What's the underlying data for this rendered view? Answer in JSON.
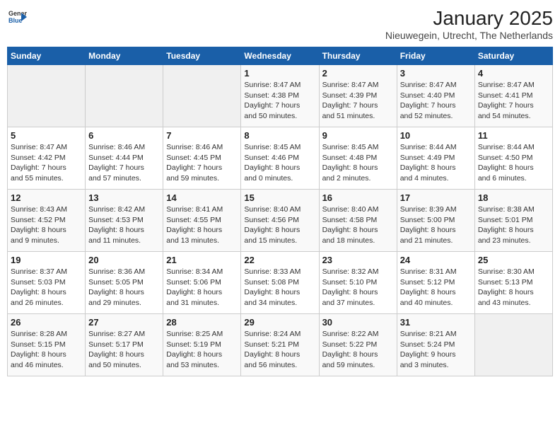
{
  "header": {
    "logo_text1": "General",
    "logo_text2": "Blue",
    "title": "January 2025",
    "subtitle": "Nieuwegein, Utrecht, The Netherlands"
  },
  "weekdays": [
    "Sunday",
    "Monday",
    "Tuesday",
    "Wednesday",
    "Thursday",
    "Friday",
    "Saturday"
  ],
  "weeks": [
    [
      {
        "day": "",
        "info": ""
      },
      {
        "day": "",
        "info": ""
      },
      {
        "day": "",
        "info": ""
      },
      {
        "day": "1",
        "info": "Sunrise: 8:47 AM\nSunset: 4:38 PM\nDaylight: 7 hours\nand 50 minutes."
      },
      {
        "day": "2",
        "info": "Sunrise: 8:47 AM\nSunset: 4:39 PM\nDaylight: 7 hours\nand 51 minutes."
      },
      {
        "day": "3",
        "info": "Sunrise: 8:47 AM\nSunset: 4:40 PM\nDaylight: 7 hours\nand 52 minutes."
      },
      {
        "day": "4",
        "info": "Sunrise: 8:47 AM\nSunset: 4:41 PM\nDaylight: 7 hours\nand 54 minutes."
      }
    ],
    [
      {
        "day": "5",
        "info": "Sunrise: 8:47 AM\nSunset: 4:42 PM\nDaylight: 7 hours\nand 55 minutes."
      },
      {
        "day": "6",
        "info": "Sunrise: 8:46 AM\nSunset: 4:44 PM\nDaylight: 7 hours\nand 57 minutes."
      },
      {
        "day": "7",
        "info": "Sunrise: 8:46 AM\nSunset: 4:45 PM\nDaylight: 7 hours\nand 59 minutes."
      },
      {
        "day": "8",
        "info": "Sunrise: 8:45 AM\nSunset: 4:46 PM\nDaylight: 8 hours\nand 0 minutes."
      },
      {
        "day": "9",
        "info": "Sunrise: 8:45 AM\nSunset: 4:48 PM\nDaylight: 8 hours\nand 2 minutes."
      },
      {
        "day": "10",
        "info": "Sunrise: 8:44 AM\nSunset: 4:49 PM\nDaylight: 8 hours\nand 4 minutes."
      },
      {
        "day": "11",
        "info": "Sunrise: 8:44 AM\nSunset: 4:50 PM\nDaylight: 8 hours\nand 6 minutes."
      }
    ],
    [
      {
        "day": "12",
        "info": "Sunrise: 8:43 AM\nSunset: 4:52 PM\nDaylight: 8 hours\nand 9 minutes."
      },
      {
        "day": "13",
        "info": "Sunrise: 8:42 AM\nSunset: 4:53 PM\nDaylight: 8 hours\nand 11 minutes."
      },
      {
        "day": "14",
        "info": "Sunrise: 8:41 AM\nSunset: 4:55 PM\nDaylight: 8 hours\nand 13 minutes."
      },
      {
        "day": "15",
        "info": "Sunrise: 8:40 AM\nSunset: 4:56 PM\nDaylight: 8 hours\nand 15 minutes."
      },
      {
        "day": "16",
        "info": "Sunrise: 8:40 AM\nSunset: 4:58 PM\nDaylight: 8 hours\nand 18 minutes."
      },
      {
        "day": "17",
        "info": "Sunrise: 8:39 AM\nSunset: 5:00 PM\nDaylight: 8 hours\nand 21 minutes."
      },
      {
        "day": "18",
        "info": "Sunrise: 8:38 AM\nSunset: 5:01 PM\nDaylight: 8 hours\nand 23 minutes."
      }
    ],
    [
      {
        "day": "19",
        "info": "Sunrise: 8:37 AM\nSunset: 5:03 PM\nDaylight: 8 hours\nand 26 minutes."
      },
      {
        "day": "20",
        "info": "Sunrise: 8:36 AM\nSunset: 5:05 PM\nDaylight: 8 hours\nand 29 minutes."
      },
      {
        "day": "21",
        "info": "Sunrise: 8:34 AM\nSunset: 5:06 PM\nDaylight: 8 hours\nand 31 minutes."
      },
      {
        "day": "22",
        "info": "Sunrise: 8:33 AM\nSunset: 5:08 PM\nDaylight: 8 hours\nand 34 minutes."
      },
      {
        "day": "23",
        "info": "Sunrise: 8:32 AM\nSunset: 5:10 PM\nDaylight: 8 hours\nand 37 minutes."
      },
      {
        "day": "24",
        "info": "Sunrise: 8:31 AM\nSunset: 5:12 PM\nDaylight: 8 hours\nand 40 minutes."
      },
      {
        "day": "25",
        "info": "Sunrise: 8:30 AM\nSunset: 5:13 PM\nDaylight: 8 hours\nand 43 minutes."
      }
    ],
    [
      {
        "day": "26",
        "info": "Sunrise: 8:28 AM\nSunset: 5:15 PM\nDaylight: 8 hours\nand 46 minutes."
      },
      {
        "day": "27",
        "info": "Sunrise: 8:27 AM\nSunset: 5:17 PM\nDaylight: 8 hours\nand 50 minutes."
      },
      {
        "day": "28",
        "info": "Sunrise: 8:25 AM\nSunset: 5:19 PM\nDaylight: 8 hours\nand 53 minutes."
      },
      {
        "day": "29",
        "info": "Sunrise: 8:24 AM\nSunset: 5:21 PM\nDaylight: 8 hours\nand 56 minutes."
      },
      {
        "day": "30",
        "info": "Sunrise: 8:22 AM\nSunset: 5:22 PM\nDaylight: 8 hours\nand 59 minutes."
      },
      {
        "day": "31",
        "info": "Sunrise: 8:21 AM\nSunset: 5:24 PM\nDaylight: 9 hours\nand 3 minutes."
      },
      {
        "day": "",
        "info": ""
      }
    ]
  ]
}
